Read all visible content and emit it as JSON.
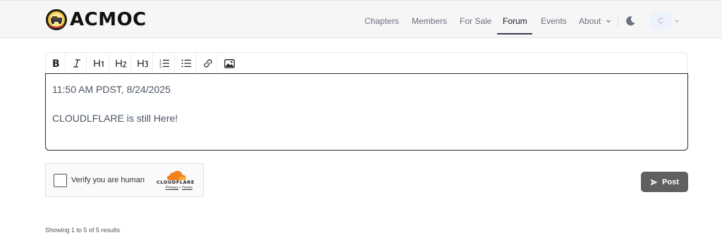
{
  "header": {
    "logo_text": "ACMOC",
    "nav": [
      {
        "label": "Chapters"
      },
      {
        "label": "Members"
      },
      {
        "label": "For Sale"
      },
      {
        "label": "Forum",
        "active": true
      },
      {
        "label": "Events"
      },
      {
        "label": "About"
      }
    ],
    "avatar_initial": "C"
  },
  "toolbar": {
    "buttons": [
      {
        "name": "bold-button",
        "icon": "bold-icon"
      },
      {
        "name": "italic-button",
        "icon": "italic-icon"
      },
      {
        "name": "heading-1-button",
        "label": "H1"
      },
      {
        "name": "heading-2-button",
        "label": "H2"
      },
      {
        "name": "heading-3-button",
        "label": "H3"
      },
      {
        "name": "ordered-list-button",
        "icon": "ordered-list-icon"
      },
      {
        "name": "bullet-list-button",
        "icon": "bullet-list-icon"
      },
      {
        "name": "link-button",
        "icon": "link-icon"
      },
      {
        "name": "image-button",
        "icon": "image-icon"
      }
    ]
  },
  "editor": {
    "lines": [
      "11:50 AM PDST, 8/24/2025",
      "CLOUDLFLARE is still Here!"
    ]
  },
  "turnstile": {
    "label": "Verify you are human",
    "brand": "CLOUDFLARE",
    "privacy": "Privacy",
    "separator": "•",
    "terms": "Terms"
  },
  "post_button": {
    "label": "Post"
  },
  "pagination": {
    "summary": "Showing 1 to 5 of 5 results"
  },
  "colors": {
    "header_bg": "#f6f6f6",
    "post_button_bg": "#5f6062",
    "cloudflare_orange": "#f48120",
    "editor_border": "#2b2b2b"
  }
}
